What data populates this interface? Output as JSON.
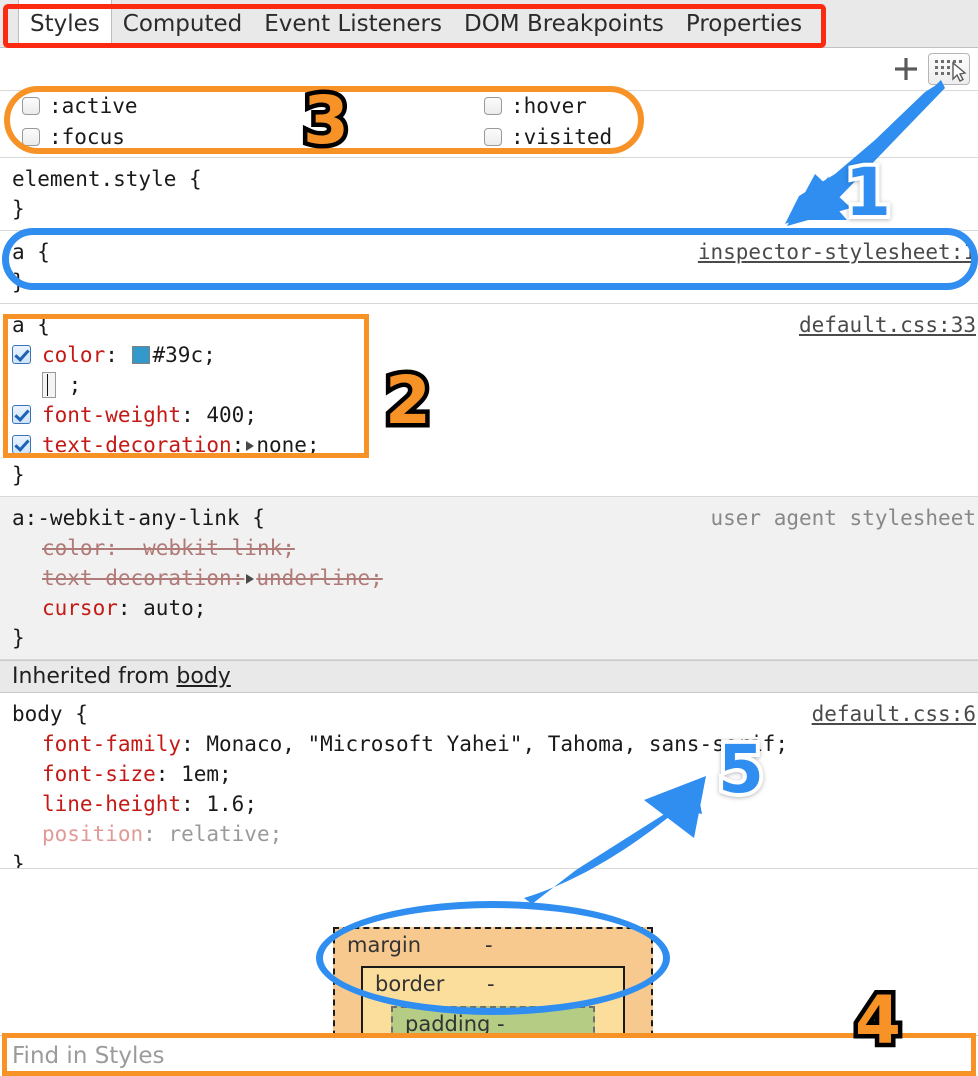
{
  "panel": {
    "title": "Styles",
    "tabs": [
      {
        "label": "Styles",
        "active": true
      },
      {
        "label": "Computed",
        "active": false
      },
      {
        "label": "Event Listeners",
        "active": false
      },
      {
        "label": "DOM Breakpoints",
        "active": false
      },
      {
        "label": "Properties",
        "active": false
      }
    ]
  },
  "toolbar": {
    "new_rule_icon": "plus-icon",
    "new_rule_label": "+",
    "element_picker_icon": "element-state-picker-icon"
  },
  "pseudo_states": [
    {
      "label": ":active",
      "checked": false
    },
    {
      "label": ":focus",
      "checked": false
    },
    {
      "label": ":hover",
      "checked": false
    },
    {
      "label": ":visited",
      "checked": false
    }
  ],
  "rules": [
    {
      "selector": "element.style {",
      "close": "}",
      "origin": "",
      "declarations": []
    },
    {
      "selector": "a {",
      "close": "}",
      "origin": "inspector-stylesheet:1",
      "declarations": []
    },
    {
      "selector": "a {",
      "close": "}",
      "origin": "default.css:33",
      "declarations": [
        {
          "checked": true,
          "prop": "color",
          "value": "#39c",
          "swatch": "#3399cc",
          "state": "normal"
        },
        {
          "checked": true,
          "prop": "",
          "value": "",
          "state": "editing"
        },
        {
          "checked": true,
          "prop": "font-weight",
          "value": "400",
          "state": "normal"
        },
        {
          "checked": true,
          "prop": "text-decoration",
          "value": "none",
          "expandable": true,
          "state": "normal"
        }
      ]
    },
    {
      "selector": "a:-webkit-any-link {",
      "close": "}",
      "origin": "user agent stylesheet",
      "declarations": [
        {
          "checked": false,
          "prop": "color",
          "value": "-webkit-link",
          "state": "disabled"
        },
        {
          "checked": false,
          "prop": "text-decoration",
          "value": "underline",
          "expandable": true,
          "state": "disabled"
        },
        {
          "checked": false,
          "prop": "cursor",
          "value": "auto",
          "state": "normal"
        }
      ]
    }
  ],
  "inherited": {
    "prefix": "Inherited from",
    "source": "body"
  },
  "body_rule": {
    "selector": "body {",
    "close": "}",
    "origin": "default.css:6",
    "declarations": [
      {
        "prop": "font-family",
        "value": "Monaco, \"Microsoft Yahei\", Tahoma, sans-serif",
        "state": "normal"
      },
      {
        "prop": "font-size",
        "value": "1em",
        "state": "normal"
      },
      {
        "prop": "line-height",
        "value": "1.6",
        "state": "normal"
      },
      {
        "prop": "position",
        "value": "relative",
        "state": "greyed"
      }
    ]
  },
  "box_model": {
    "margin": {
      "label": "margin",
      "value": "-"
    },
    "border": {
      "label": "border",
      "value": "-"
    },
    "padding": {
      "label": "padding",
      "value": "-"
    }
  },
  "find": {
    "placeholder": "Find in Styles",
    "value": ""
  },
  "annotations": {
    "markers": [
      {
        "id": "1",
        "color": "#2f8ef0",
        "style": "blue"
      },
      {
        "id": "2",
        "color": "#f79226",
        "style": "orange"
      },
      {
        "id": "3",
        "color": "#f79226",
        "style": "orange"
      },
      {
        "id": "4",
        "color": "#f79226",
        "style": "orange"
      },
      {
        "id": "5",
        "color": "#2f8ef0",
        "style": "blue"
      }
    ],
    "colors": {
      "red_box": "#fb2a10",
      "orange": "#f79226",
      "blue": "#2f8ef0"
    }
  }
}
